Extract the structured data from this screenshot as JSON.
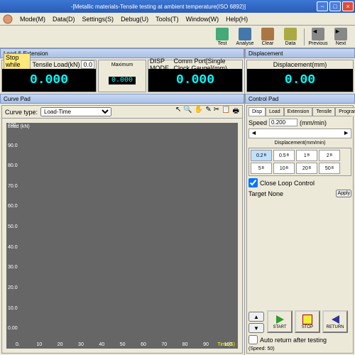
{
  "window": {
    "title": "-[Metallic materials-Tensile testing at ambient temperature(ISO 6892)]"
  },
  "menu": {
    "mode": "Mode(M)",
    "data": "Data(D)",
    "settings": "Settings(S)",
    "debug": "Debug(U)",
    "tools": "Tools(T)",
    "window": "Window(W)",
    "help": "Help(H)"
  },
  "toolbar": {
    "test": "Test",
    "analyse": "Analyse",
    "clear": "Clear",
    "data": "Data",
    "previous": "Previous",
    "next": "Next"
  },
  "readout_left": {
    "header": "Load & Extension",
    "r1": {
      "badge": "Stop while destroy",
      "l1": "Tensile",
      "l2": "Load(kN)",
      "v": "0.0",
      "disp": "0.000"
    },
    "mid": {
      "top": "Maximum",
      "val": "0.000"
    },
    "r2": {
      "l1": "DISP MODE",
      "l2": "Comm Port[Single Clock Gauge](mm)",
      "disp": "0.000"
    }
  },
  "readout_right": {
    "header": "Displacement",
    "label": "Displacement(mm)",
    "disp": "0.00"
  },
  "curve": {
    "header": "Curve Pad",
    "type_label": "Curve type:",
    "type_value": "Load-Time",
    "ylabel": "Load (kN)",
    "xlabel": "Time(S)",
    "yticks": [
      "100.",
      "90.0",
      "80.0",
      "70.0",
      "60.0",
      "50.0",
      "40.0",
      "30.0",
      "20.0",
      "10.0",
      "0.00"
    ],
    "xticks": [
      "0.",
      "10",
      "20",
      "30",
      "40",
      "50",
      "60",
      "70",
      "80",
      "90",
      "100"
    ]
  },
  "control": {
    "header": "Control Pad",
    "tabs": {
      "disp": "Disp",
      "load": "Load",
      "ext": "Extension",
      "tensile": "Tensile",
      "prog": "Program"
    },
    "speed_label": "Speed",
    "speed_val": "0.200",
    "speed_unit": "(mm/min)",
    "grid_label": "Displacement(mm/min)",
    "buttons": [
      "0.2",
      "0.5",
      "1",
      "2",
      "5",
      "10",
      "20",
      "50"
    ],
    "close_loop": "Close Loop Control",
    "target": "Target None",
    "apply": "Apply",
    "start": "START",
    "stop": "STOP",
    "return": "RETURN",
    "auto": "Auto return after testing",
    "speed2": "(Speed: 50)"
  }
}
